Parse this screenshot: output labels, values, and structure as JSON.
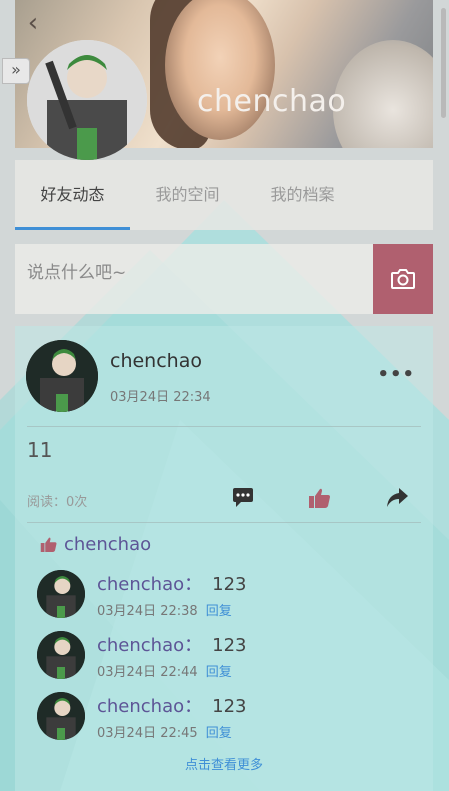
{
  "header": {
    "username": "chenchao",
    "back_icon": "chevron-left-icon",
    "expand_icon": "double-chevron-right-icon"
  },
  "tabs": [
    {
      "label": "好友动态",
      "active": true
    },
    {
      "label": "我的空间",
      "active": false
    },
    {
      "label": "我的档案",
      "active": false
    }
  ],
  "post_input": {
    "placeholder": "说点什么吧~",
    "camera_icon": "camera-icon"
  },
  "post": {
    "author": "chenchao",
    "time": "03月24日 22:34",
    "more_icon": "more-dots-icon",
    "content": "11",
    "read_count": "阅读：0次",
    "actions": [
      "comment-icon",
      "like-icon",
      "share-icon"
    ],
    "likes": {
      "icon": "like-icon",
      "users": "chenchao"
    },
    "comments": [
      {
        "name": "chenchao",
        "sep": "：",
        "text": "123",
        "time": "03月24日 22:38",
        "reply": "回复"
      },
      {
        "name": "chenchao",
        "sep": "：",
        "text": "123",
        "time": "03月24日 22:44",
        "reply": "回复"
      },
      {
        "name": "chenchao",
        "sep": "：",
        "text": "123",
        "time": "03月24日 22:45",
        "reply": "回复"
      }
    ],
    "see_more": "点击查看更多"
  },
  "colors": {
    "accent": "#3f8fd6",
    "camera_bg": "#b0606f",
    "name_color": "#5d5596",
    "teal_bg": "#a9e2e0"
  }
}
